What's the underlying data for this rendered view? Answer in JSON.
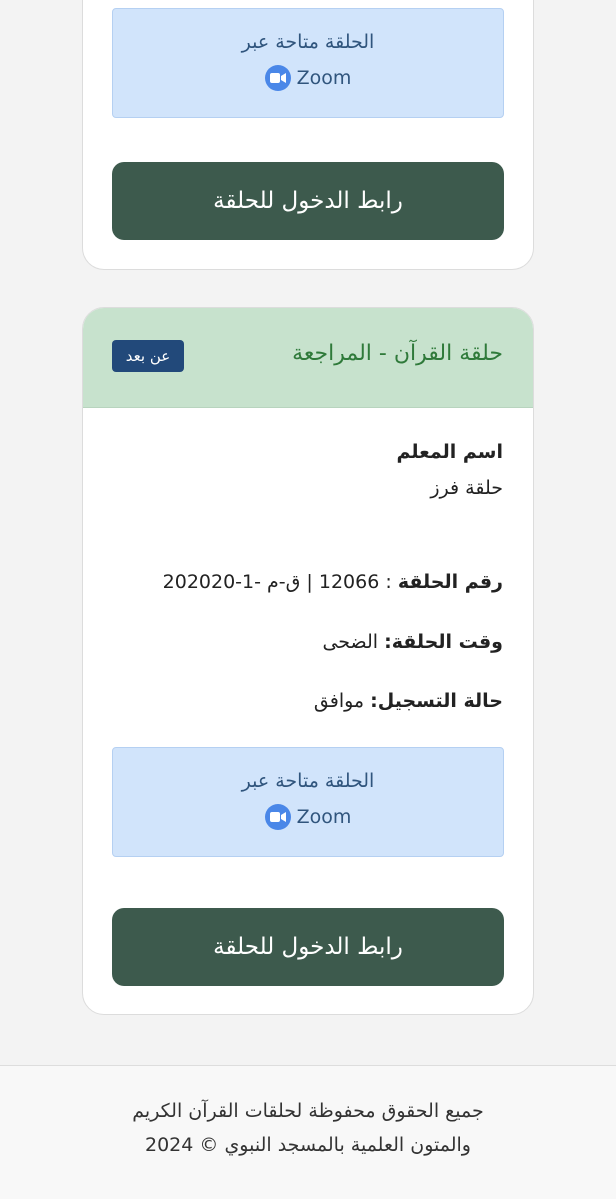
{
  "top_card": {
    "zoom_text": "الحلقة متاحة عبر",
    "zoom_label": "Zoom",
    "enter_button": "رابط الدخول للحلقة"
  },
  "main_card": {
    "title": "حلقة القرآن - المراجعة",
    "badge": "عن بعد",
    "teacher_label": "اسم المعلم",
    "teacher_value": "حلقة فرز",
    "circle_number_label": "رقم الحلقة",
    "circle_number_value": " : 12066 | ق-م -1-202020",
    "time_label": "وقت الحلقة:",
    "time_value": " الضحى",
    "status_label": "حالة التسجيل:",
    "status_value": " موافق",
    "zoom_text": "الحلقة متاحة عبر",
    "zoom_label": "Zoom",
    "enter_button": "رابط الدخول للحلقة"
  },
  "footer": {
    "line1": "جميع الحقوق محفوظة لحلقات القرآن الكريم",
    "line2": "والمتون العلمية بالمسجد النبوي © 2024"
  },
  "colors": {
    "header_green": "#c7e2cd",
    "title_green": "#2f7a3a",
    "button_dark_green": "#3d5a4d",
    "badge_blue": "#22497a",
    "zoom_box_blue": "#d1e4fb",
    "zoom_icon_blue": "#4a87e8"
  }
}
